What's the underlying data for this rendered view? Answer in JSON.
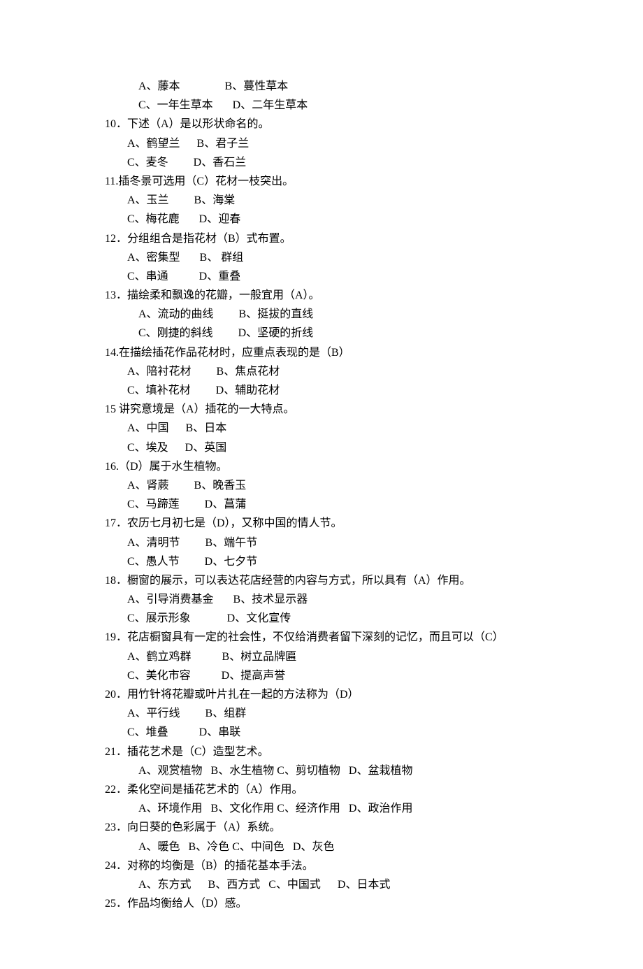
{
  "lines": [
    {
      "cls": "opt-row-indent",
      "text": "A、藤本                B、蔓性草本"
    },
    {
      "cls": "opt-row-indent",
      "text": "C、一年生草本       D、二年生草本"
    },
    {
      "cls": "q-text",
      "text": "10．下述（A）是以形状命名的。"
    },
    {
      "cls": "opt-row",
      "text": "A、鹤望兰      B、君子兰"
    },
    {
      "cls": "opt-row",
      "text": "C、麦冬         D、香石兰"
    },
    {
      "cls": "q-text",
      "text": "11.插冬景可选用（C）花材一枝突出。"
    },
    {
      "cls": "opt-row",
      "text": "A、玉兰         B、海棠"
    },
    {
      "cls": "opt-row",
      "text": "C、梅花鹿       D、迎春"
    },
    {
      "cls": "q-text",
      "text": "12．分组组合是指花材（B）式布置。"
    },
    {
      "cls": "opt-row",
      "text": "A、密集型       B、 群组"
    },
    {
      "cls": "opt-row",
      "text": "C、串通           D、重叠"
    },
    {
      "cls": "q-text",
      "text": "13．描绘柔和飘逸的花瓣，一般宜用（A）。"
    },
    {
      "cls": "opt-row-indent",
      "text": "A、流动的曲线         B、挺拔的直线"
    },
    {
      "cls": "opt-row-indent",
      "text": "C、刚捷的斜线         D、坚硬的折线"
    },
    {
      "cls": "q-text",
      "text": "14.在描绘插花作品花材时，应重点表现的是（B）"
    },
    {
      "cls": "opt-row",
      "text": "A、陪衬花材         B、焦点花材"
    },
    {
      "cls": "opt-row",
      "text": "C、填补花材         D、辅助花材"
    },
    {
      "cls": "q-text",
      "text": "15 讲究意境是（A）插花的一大特点。"
    },
    {
      "cls": "opt-row",
      "text": "A、中国      B、日本"
    },
    {
      "cls": "opt-row",
      "text": "C、埃及      D、英国"
    },
    {
      "cls": "q-text",
      "text": "16.（D）属于水生植物。"
    },
    {
      "cls": "opt-row",
      "text": "A、肾蕨         B、晚香玉"
    },
    {
      "cls": "opt-row",
      "text": "C、马蹄莲         D、菖蒲"
    },
    {
      "cls": "q-text",
      "text": "17．农历七月初七是（D），又称中国的情人节。"
    },
    {
      "cls": "opt-row",
      "text": "A、清明节         B、端午节"
    },
    {
      "cls": "opt-row",
      "text": "C、愚人节         D、七夕节"
    },
    {
      "cls": "q-text",
      "text": "18．橱窗的展示，可以表达花店经营的内容与方式，所以具有（A）作用。"
    },
    {
      "cls": "opt-row",
      "text": "A、引导消费基金       B、技术显示器"
    },
    {
      "cls": "opt-row",
      "text": "C、展示形象             D、文化宣传"
    },
    {
      "cls": "q-text",
      "text": "19．花店橱窗具有一定的社会性，不仅给消费者留下深刻的记忆，而且可以（C）"
    },
    {
      "cls": "opt-row",
      "text": "A、鹤立鸡群           B、树立品牌匾"
    },
    {
      "cls": "opt-row",
      "text": "C、美化市容           D、提高声誉"
    },
    {
      "cls": "q-text",
      "text": "20．用竹针将花瓣或叶片扎在一起的方法称为（D）"
    },
    {
      "cls": "opt-row",
      "text": "A、平行线         B、组群"
    },
    {
      "cls": "opt-row",
      "text": "C、堆叠           D、串联"
    },
    {
      "cls": "q-text",
      "text": "21．插花艺术是（C）造型艺术。"
    },
    {
      "cls": "inline-opts",
      "text": "A、观赏植物   B、水生植物 C、剪切植物   D、盆栽植物"
    },
    {
      "cls": "q-text",
      "text": "22．柔化空间是插花艺术的（A）作用。"
    },
    {
      "cls": "inline-opts",
      "text": "A、环境作用   B、文化作用 C、经济作用   D、政治作用"
    },
    {
      "cls": "q-text",
      "text": "23．向日葵的色彩属于（A）系统。"
    },
    {
      "cls": "inline-opts",
      "text": "A、暖色   B、冷色 C、中间色   D、灰色"
    },
    {
      "cls": "q-text",
      "text": "24．对称的均衡是（B）的插花基本手法。"
    },
    {
      "cls": "inline-opts",
      "text": "A、东方式      B、西方式   C、中国式      D、日本式"
    },
    {
      "cls": "q-text",
      "text": "25．作品均衡给人（D）感。"
    }
  ]
}
